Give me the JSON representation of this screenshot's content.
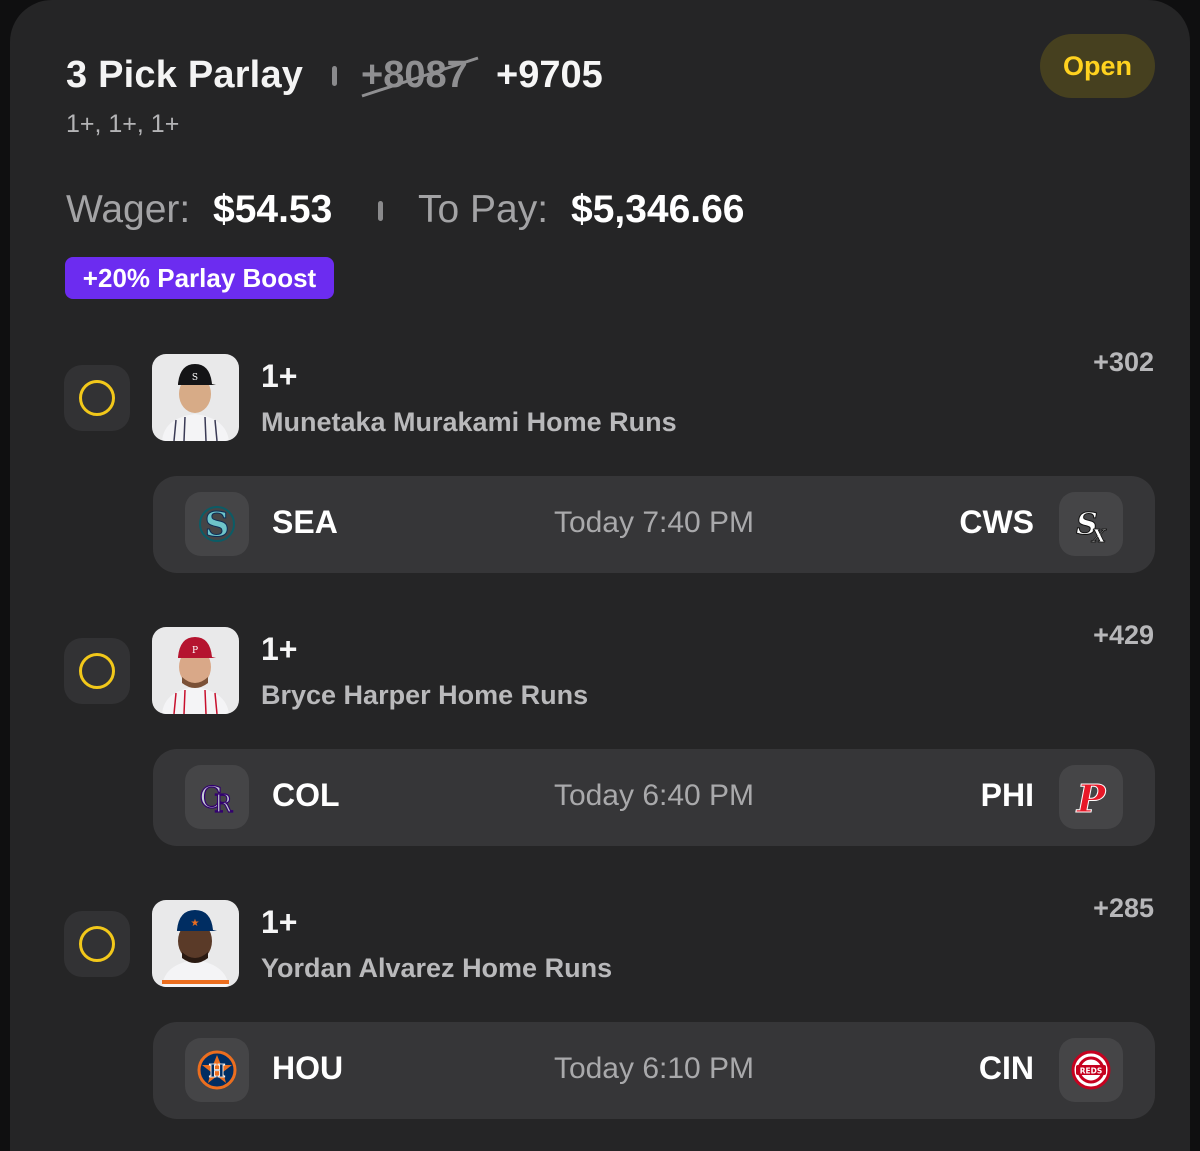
{
  "header": {
    "title": "3 Pick Parlay",
    "old_odds": "+8087",
    "new_odds": "+9705",
    "subtitle": "1+, 1+, 1+",
    "status": "Open"
  },
  "wager": {
    "wager_label": "Wager:",
    "wager_value": "$54.53",
    "topay_label": "To Pay:",
    "topay_value": "$5,346.66"
  },
  "boost": {
    "label": "+20% Parlay Boost"
  },
  "picks": [
    {
      "line": "1+",
      "market": "Munetaka Murakami Home Runs",
      "odds": "+302",
      "away": "SEA",
      "home": "CWS",
      "time": "Today 7:40 PM",
      "away_logo_icon": "mariners-logo-icon",
      "home_logo_icon": "white-sox-logo-icon"
    },
    {
      "line": "1+",
      "market": "Bryce Harper Home Runs",
      "odds": "+429",
      "away": "COL",
      "home": "PHI",
      "time": "Today 6:40 PM",
      "away_logo_icon": "rockies-logo-icon",
      "home_logo_icon": "phillies-logo-icon"
    },
    {
      "line": "1+",
      "market": "Yordan Alvarez Home Runs",
      "odds": "+285",
      "away": "HOU",
      "home": "CIN",
      "time": "Today 6:10 PM",
      "away_logo_icon": "astros-logo-icon",
      "home_logo_icon": "reds-logo-icon"
    }
  ],
  "colors": {
    "card_bg": "#252526",
    "accent_yellow": "#f2c81a",
    "boost_purple": "#6c2cf0",
    "status_bg": "#46401f"
  }
}
